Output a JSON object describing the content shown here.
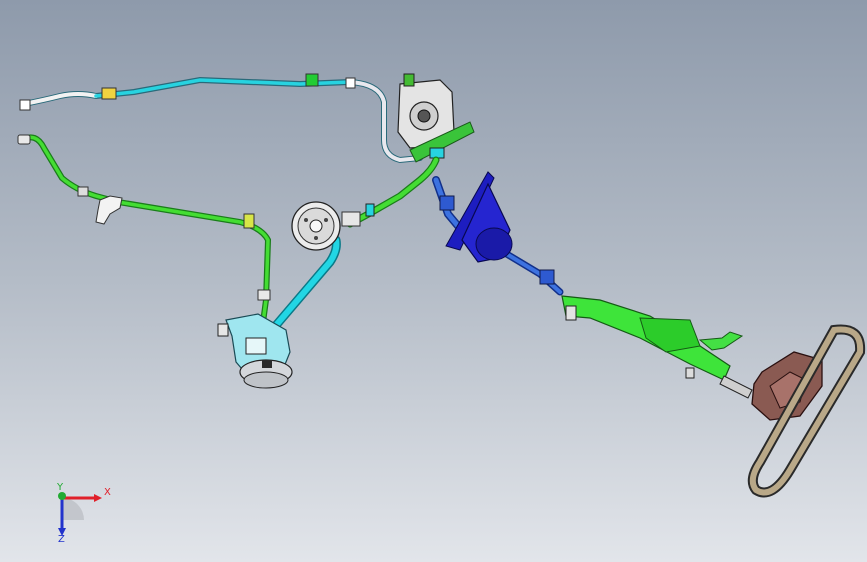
{
  "viewport": {
    "background_top": "#8e9aab",
    "background_bottom": "#e2e5ea"
  },
  "triad": {
    "x_label": "X",
    "y_label": "Y",
    "z_label": "Z",
    "x_color": "#e0202a",
    "y_color": "#22aa33",
    "z_color": "#2233cc"
  },
  "parts": {
    "steering_wheel_color": "#8a5a52",
    "steering_column_color": "#33dd22",
    "column_bracket_color": "#2222cc",
    "shaft_joint_color": "#3a6fd8",
    "high_pressure_hose_color": "#00c8dc",
    "return_line_color": "#22bb22",
    "pump_body_color": "#cfd2d6",
    "pulley_color": "#e6e6e6"
  }
}
